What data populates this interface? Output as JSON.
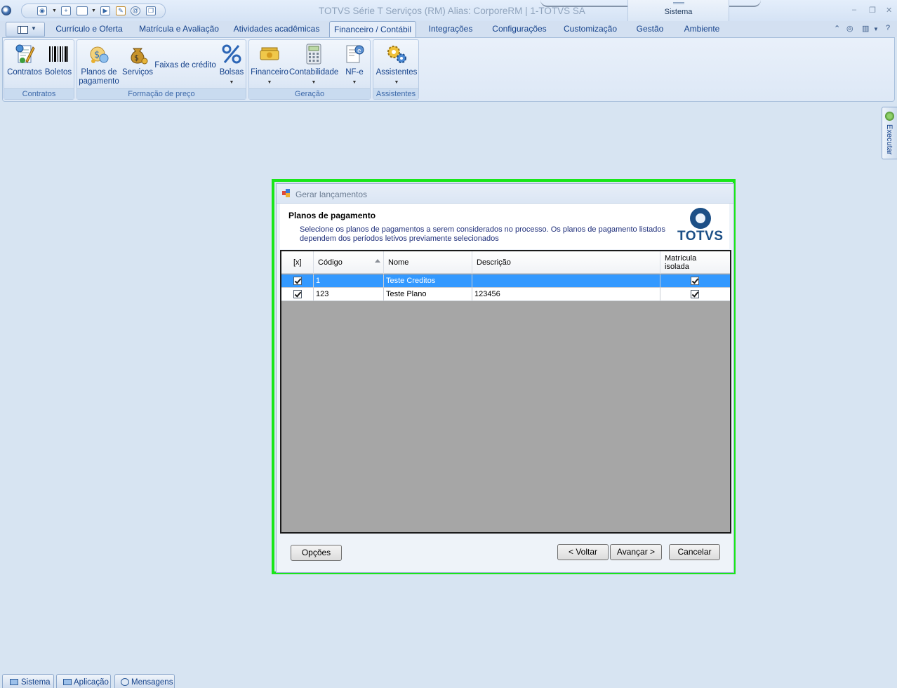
{
  "window": {
    "title": "TOTVS Série T Serviços (RM) Alias: CorporeRM | 1-TOTVS SA",
    "context_tab_group": "Sistema",
    "controls": [
      "–",
      "❐",
      "✕"
    ]
  },
  "ribbon_tabs": [
    {
      "label": "Currículo e Oferta"
    },
    {
      "label": "Matrícula e Avaliação"
    },
    {
      "label": "Atividades acadêmicas"
    },
    {
      "label": "Financeiro / Contábil"
    },
    {
      "label": "Integrações"
    },
    {
      "label": "Configurações"
    },
    {
      "label": "Customização"
    },
    {
      "label": "Gestão"
    },
    {
      "label": "Ambiente"
    }
  ],
  "active_tab": "Financeiro / Contábil",
  "ribbon_groups": {
    "contratos": {
      "label": "Contratos",
      "buttons": [
        "Contratos",
        "Boletos"
      ]
    },
    "formacao": {
      "label": "Formação de preço",
      "buttons": [
        "Planos de pagamento",
        "Serviços",
        "Faixas de crédito",
        "Bolsas"
      ]
    },
    "geracao": {
      "label": "Geração",
      "buttons": [
        "Financeiro",
        "Contabilidade",
        "NF-e"
      ]
    },
    "assistentes": {
      "label": "Assistentes",
      "buttons": [
        "Assistentes"
      ]
    }
  },
  "side_panel": {
    "label": "Executar"
  },
  "dialog": {
    "title": "Gerar lançamentos",
    "header_title": "Planos de pagamento",
    "header_desc": "Selecione os planos de pagamentos a serem considerados no processo. Os planos de pagamento listados dependem dos períodos letivos previamente selecionados",
    "logo_text": "TOTVS",
    "columns": [
      "[x]",
      "Código",
      "Nome",
      "Descrição",
      "Matrícula isolada"
    ],
    "rows": [
      {
        "checked": true,
        "codigo": "1",
        "nome": "Teste Creditos",
        "descricao": "",
        "matricula_isolada": true,
        "selected": true
      },
      {
        "checked": true,
        "codigo": "123",
        "nome": "Teste Plano",
        "descricao": "123456",
        "matricula_isolada": true,
        "selected": false
      }
    ],
    "buttons": {
      "opcoes": "Opções",
      "voltar": "< Voltar",
      "avancar": "Avançar >",
      "cancelar": "Cancelar"
    }
  },
  "statusbar": {
    "tabs": [
      "Sistema",
      "Aplicação",
      "Mensagens"
    ]
  }
}
